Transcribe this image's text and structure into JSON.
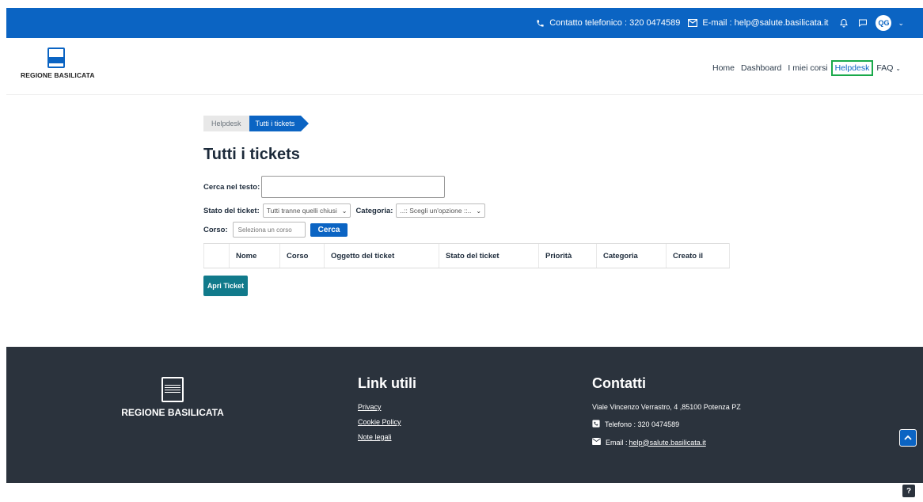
{
  "topbar": {
    "phone_text": "Contatto telefonico : 320 0474589",
    "email_text": "E-mail : help@salute.basilicata.it",
    "avatar_initials": "QG"
  },
  "header": {
    "logo_text": "REGIONE BASILICATA",
    "nav": [
      "Home",
      "Dashboard",
      "I miei corsi",
      "Helpdesk",
      "FAQ"
    ],
    "active_nav": "Helpdesk"
  },
  "breadcrumb": [
    "Helpdesk",
    "Tutti i tickets"
  ],
  "page_title": "Tutti i tickets",
  "form": {
    "search_label": "Cerca nel testo:",
    "search_value": "",
    "status_label": "Stato del ticket:",
    "status_selected": "Tutti tranne quelli chiusi",
    "category_label": "Categoria:",
    "category_selected": "..:: Scegli un'opzione ::..",
    "course_label": "Corso:",
    "course_placeholder": "Seleziona un corso",
    "search_button": "Cerca"
  },
  "table": {
    "columns": [
      "",
      "Nome",
      "Corso",
      "Oggetto del ticket",
      "Stato del ticket",
      "Priorità",
      "Categoria",
      "Creato il"
    ]
  },
  "open_ticket_button": "Apri Ticket",
  "footer": {
    "logo_text": "REGIONE BASILICATA",
    "links_title": "Link utili",
    "links": [
      "Privacy",
      "Cookie Policy",
      "Note legali"
    ],
    "contacts_title": "Contatti",
    "address": "Viale Vincenzo Verrastro, 4 ,85100 Potenza PZ",
    "phone": "Telefono : 320 0474589",
    "email_label": "Email : ",
    "email": "help@salute.basilicata.it"
  },
  "help_button": "?",
  "colors": {
    "primary": "#0b64c3",
    "teal_button": "#117a8b",
    "footer_bg": "#2b333d",
    "active_outline": "#19a94a"
  }
}
